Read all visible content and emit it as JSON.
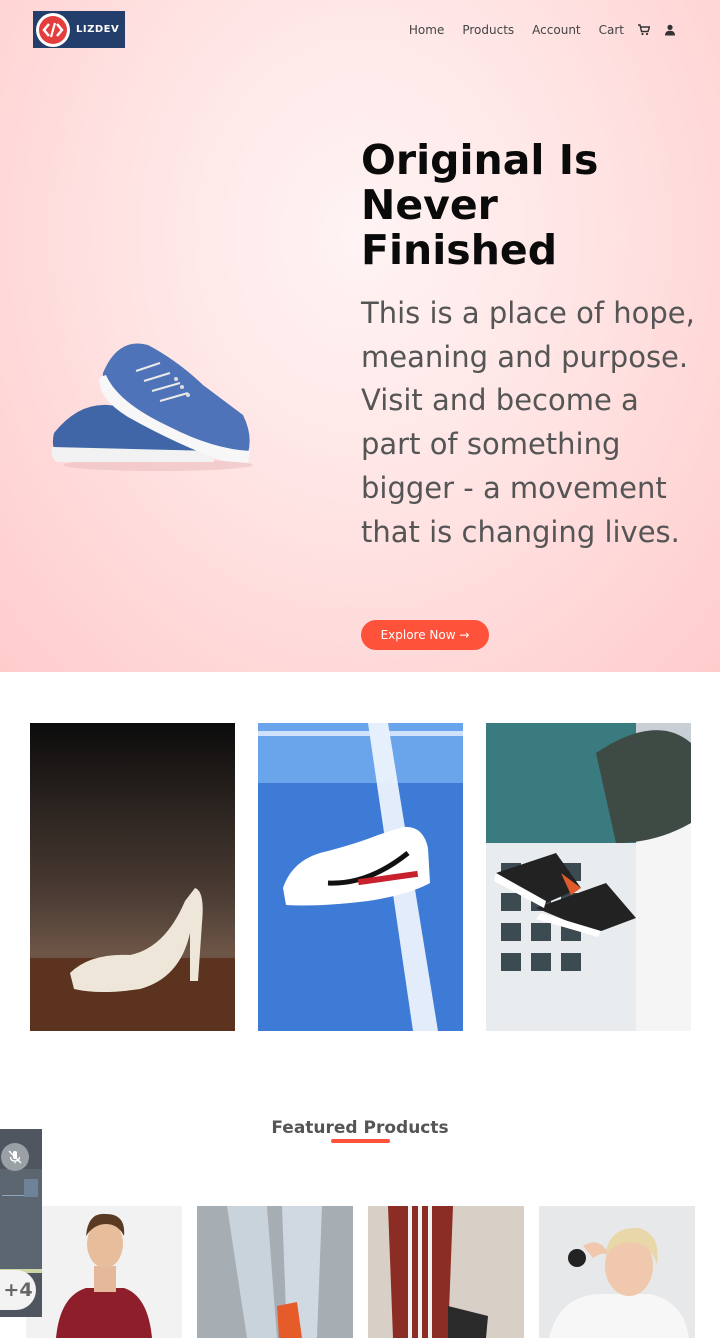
{
  "brand": {
    "name": "LIZDEV",
    "logo_icon": "code-brackets-icon"
  },
  "nav": {
    "items": [
      "Home",
      "Products",
      "Account",
      "Cart"
    ],
    "icons": [
      "cart-icon",
      "user-icon"
    ]
  },
  "hero": {
    "title": "Original Is Never Finished",
    "description": "This is a place of hope, meaning and purpose. Visit and become a part of something bigger - a movement that is changing lives.",
    "cta_label": "Explore Now →"
  },
  "featured": {
    "title": "Featured Products"
  },
  "side_widget": {
    "badge": "+4",
    "icon": "mic-off-icon"
  },
  "colors": {
    "accent": "#ff523b",
    "brand_bg": "#243e6b",
    "hero_bg": "#ffd6d6"
  }
}
